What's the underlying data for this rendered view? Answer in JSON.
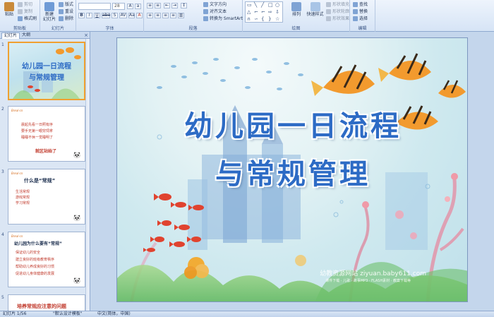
{
  "ribbon": {
    "clipboard": {
      "label": "剪贴板",
      "paste": "粘贴",
      "cut": "剪切",
      "copy": "复制",
      "format_painter": "格式刷"
    },
    "slides": {
      "label": "幻灯片",
      "new_slide": "新建\n幻灯片",
      "layout": "版式",
      "reset": "重设",
      "delete": "删除"
    },
    "font": {
      "label": "字体",
      "font_name": "",
      "font_size": "28",
      "bold": "B",
      "italic": "I",
      "underline": "U",
      "strike": "abe",
      "shadow": "S",
      "spacing": "AV",
      "case": "Aa",
      "color": "A"
    },
    "paragraph": {
      "label": "段落",
      "text_direction": "文字方向",
      "align_text": "对齐文本",
      "smartart": "转换为 SmartArt"
    },
    "drawing": {
      "label": "绘图",
      "arrange": "排列",
      "quick_styles": "快速样式",
      "shape_fill": "形状填充",
      "shape_outline": "形状轮廓",
      "shape_effects": "形状效果"
    },
    "editing": {
      "label": "编辑",
      "find": "查找",
      "replace": "替换",
      "select": "选择"
    }
  },
  "left_pane": {
    "tabs": [
      "幻灯片",
      "大纲"
    ],
    "close": "×",
    "thumbnails": [
      {
        "num": "1",
        "title1": "幼儿园一日流程",
        "title2": "与常规管理"
      },
      {
        "num": "2",
        "tag": "Breal·cn",
        "lines": [
          "晨起先看一日照有序",
          "要手无第一眼穷饲拿",
          "睡睡不休一觉睡明了"
        ],
        "footer": "就区站始了"
      },
      {
        "num": "3",
        "tag": "Breal·cn",
        "title": "什么是“常规”",
        "bullets": [
          "生活常规",
          "游戏常规",
          "学习常规"
        ]
      },
      {
        "num": "4",
        "tag": "Breal·cn",
        "title": "幼儿园为什么要有“常规”",
        "bullets": [
          "保证幼儿的安全",
          "建立良好的班级教育秩序",
          "帮助幼儿养成良好的习惯",
          "促进幼儿身体健康的发展"
        ]
      },
      {
        "num": "5",
        "title": "培养常规应注意的问题"
      }
    ]
  },
  "slide": {
    "title_line1": "幼儿园一日流程",
    "title_line2": "与常规管理",
    "watermark": "幼教资源网站 ziyuan.baby611.com",
    "watermark_sub": "课件下载 · 儿歌 · 故事MP3 · FLASH素材 · 教案下载等"
  },
  "statusbar": {
    "slide_indicator": "幻灯片 1/56",
    "theme": "\"默认设计模板\"",
    "language": "中文(简体，中国)"
  },
  "colors": {
    "accent": "#2d6bc5",
    "ribbon_bg": "#dbe7f7",
    "selection": "#f0a030"
  }
}
